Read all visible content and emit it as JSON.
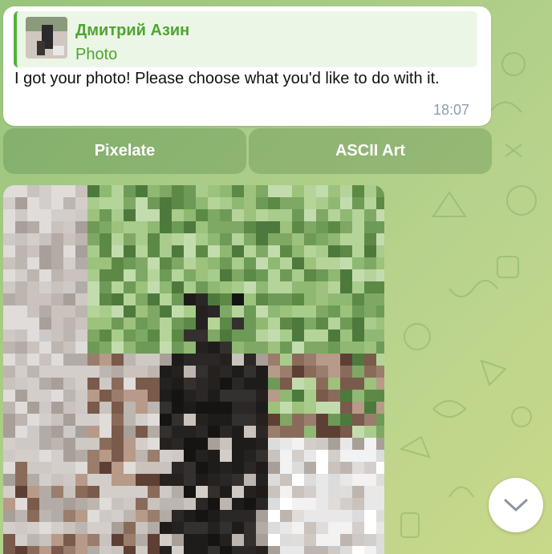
{
  "message": {
    "reply": {
      "sender": "Дмитрий Азин",
      "type": "Photo"
    },
    "text": "I got your photo! Please choose what you'd like to do with it.",
    "time": "18:07"
  },
  "keyboard": {
    "buttons": [
      "Pixelate",
      "ASCII Art"
    ]
  },
  "colors": {
    "accent": "#4fa532",
    "bubble": "#ffffff",
    "button_bg": "rgba(70,120,60,0.28)"
  },
  "icons": {
    "scroll_down": "chevron-down-icon"
  }
}
